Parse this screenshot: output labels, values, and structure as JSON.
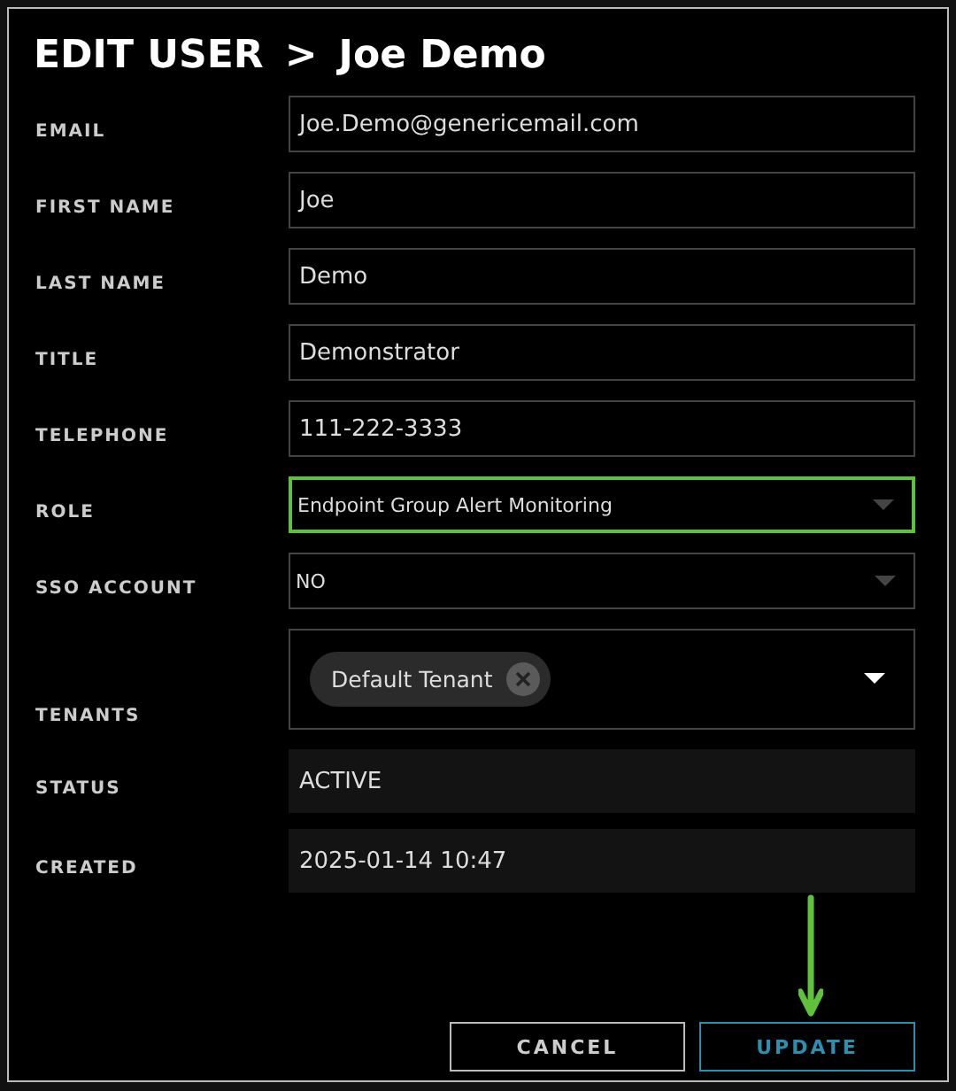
{
  "dialog": {
    "title": "EDIT USER",
    "separator": ">",
    "subject": "Joe Demo"
  },
  "fields": [
    {
      "label": "EMAIL",
      "kind": "text",
      "value": "Joe.Demo@genericemail.com",
      "highlighted": false
    },
    {
      "label": "FIRST NAME",
      "kind": "text",
      "value": "Joe",
      "highlighted": false
    },
    {
      "label": "LAST NAME",
      "kind": "text",
      "value": "Demo",
      "highlighted": false
    },
    {
      "label": "TITLE",
      "kind": "text",
      "value": "Demonstrator",
      "highlighted": false
    },
    {
      "label": "TELEPHONE",
      "kind": "text",
      "value": "111-222-3333",
      "highlighted": false
    },
    {
      "label": "ROLE",
      "kind": "select",
      "value": "Endpoint Group Alert Monitoring",
      "highlighted": true
    },
    {
      "label": "SSO ACCOUNT",
      "kind": "select",
      "value": "NO",
      "highlighted": false
    },
    {
      "label": "TENANTS",
      "kind": "tags",
      "tags": [
        "Default Tenant"
      ],
      "highlighted": false
    },
    {
      "label": "STATUS",
      "kind": "readonly",
      "value": "ACTIVE",
      "highlighted": false
    },
    {
      "label": "CREATED",
      "kind": "readonly",
      "value": "2025-01-14 10:47",
      "highlighted": false
    }
  ],
  "buttons": [
    {
      "label": "CANCEL",
      "kind": "secondary",
      "pointed": false
    },
    {
      "label": "UPDATE",
      "kind": "primary",
      "pointed": true
    }
  ]
}
